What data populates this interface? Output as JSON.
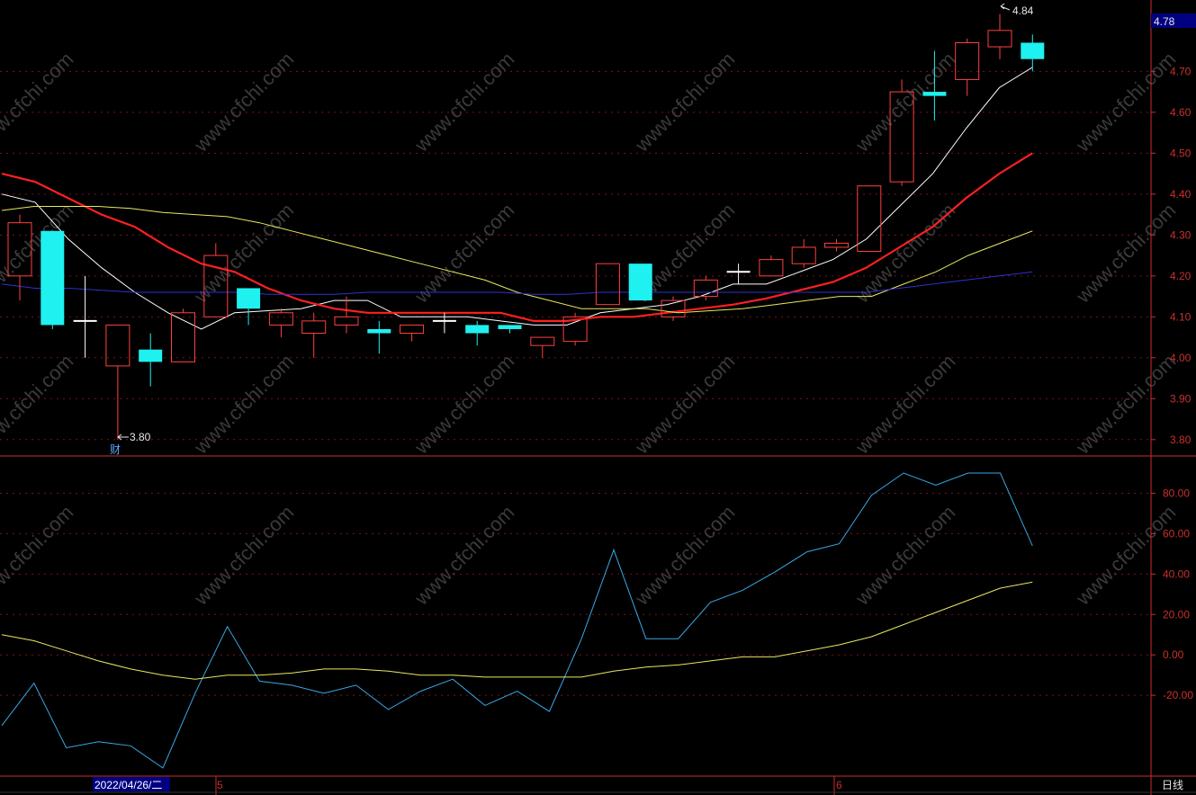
{
  "chart_data": [
    {
      "type": "candlestick",
      "ylim": [
        3.76,
        4.87
      ],
      "yticks": [
        "4.70",
        "4.60",
        "4.50",
        "4.40",
        "4.30",
        "4.20",
        "4.10",
        "4.00",
        "3.90",
        "3.80"
      ],
      "current_price": "4.78",
      "high_marker": "4.84",
      "low_marker": "3.80",
      "event_marker": "财",
      "candles": [
        {
          "o": 4.2,
          "h": 4.35,
          "l": 4.14,
          "c": 4.33
        },
        {
          "o": 4.31,
          "h": 4.31,
          "l": 4.07,
          "c": 4.08
        },
        {
          "o": 4.09,
          "h": 4.2,
          "l": 4.0,
          "c": 4.09
        },
        {
          "o": 3.98,
          "h": 4.08,
          "l": 3.8,
          "c": 4.08
        },
        {
          "o": 4.02,
          "h": 4.06,
          "l": 3.93,
          "c": 3.99
        },
        {
          "o": 3.99,
          "h": 4.12,
          "l": 3.99,
          "c": 4.11
        },
        {
          "o": 4.1,
          "h": 4.28,
          "l": 4.1,
          "c": 4.25
        },
        {
          "o": 4.17,
          "h": 4.17,
          "l": 4.08,
          "c": 4.12
        },
        {
          "o": 4.08,
          "h": 4.12,
          "l": 4.05,
          "c": 4.11
        },
        {
          "o": 4.06,
          "h": 4.11,
          "l": 4.0,
          "c": 4.09
        },
        {
          "o": 4.08,
          "h": 4.15,
          "l": 4.06,
          "c": 4.1
        },
        {
          "o": 4.07,
          "h": 4.09,
          "l": 4.01,
          "c": 4.06
        },
        {
          "o": 4.06,
          "h": 4.08,
          "l": 4.04,
          "c": 4.08
        },
        {
          "o": 4.09,
          "h": 4.11,
          "l": 4.06,
          "c": 4.09
        },
        {
          "o": 4.08,
          "h": 4.09,
          "l": 4.03,
          "c": 4.06
        },
        {
          "o": 4.08,
          "h": 4.08,
          "l": 4.06,
          "c": 4.07
        },
        {
          "o": 4.03,
          "h": 4.05,
          "l": 4.0,
          "c": 4.05
        },
        {
          "o": 4.04,
          "h": 4.11,
          "l": 4.03,
          "c": 4.1
        },
        {
          "o": 4.13,
          "h": 4.23,
          "l": 4.13,
          "c": 4.23
        },
        {
          "o": 4.23,
          "h": 4.23,
          "l": 4.14,
          "c": 4.14
        },
        {
          "o": 4.1,
          "h": 4.15,
          "l": 4.09,
          "c": 4.14
        },
        {
          "o": 4.15,
          "h": 4.2,
          "l": 4.14,
          "c": 4.19
        },
        {
          "o": 4.21,
          "h": 4.23,
          "l": 4.18,
          "c": 4.21
        },
        {
          "o": 4.2,
          "h": 4.25,
          "l": 4.2,
          "c": 4.24
        },
        {
          "o": 4.23,
          "h": 4.29,
          "l": 4.22,
          "c": 4.27
        },
        {
          "o": 4.27,
          "h": 4.29,
          "l": 4.26,
          "c": 4.28
        },
        {
          "o": 4.26,
          "h": 4.42,
          "l": 4.26,
          "c": 4.42
        },
        {
          "o": 4.43,
          "h": 4.68,
          "l": 4.42,
          "c": 4.65
        },
        {
          "o": 4.65,
          "h": 4.75,
          "l": 4.58,
          "c": 4.64
        },
        {
          "o": 4.68,
          "h": 4.78,
          "l": 4.64,
          "c": 4.77
        },
        {
          "o": 4.76,
          "h": 4.84,
          "l": 4.73,
          "c": 4.8
        },
        {
          "o": 4.77,
          "h": 4.79,
          "l": 4.7,
          "c": 4.73
        }
      ],
      "ma_series": [
        {
          "color": "#ffffff",
          "values": [
            4.4,
            4.38,
            4.29,
            4.22,
            4.16,
            4.11,
            4.07,
            4.11,
            4.115,
            4.12,
            4.14,
            4.14,
            4.1,
            4.1,
            4.1,
            4.09,
            4.08,
            4.08,
            4.11,
            4.12,
            4.13,
            4.15,
            4.18,
            4.18,
            4.21,
            4.24,
            4.29,
            4.37,
            4.45,
            4.56,
            4.66,
            4.71
          ]
        },
        {
          "color": "#ff2020",
          "values": [
            4.45,
            4.43,
            4.39,
            4.35,
            4.32,
            4.27,
            4.23,
            4.21,
            4.17,
            4.14,
            4.12,
            4.11,
            4.11,
            4.11,
            4.11,
            4.11,
            4.09,
            4.09,
            4.1,
            4.1,
            4.11,
            4.12,
            4.13,
            4.145,
            4.165,
            4.185,
            4.22,
            4.27,
            4.32,
            4.39,
            4.45,
            4.5
          ]
        },
        {
          "color": "#e8e860",
          "values": [
            4.36,
            4.37,
            4.37,
            4.37,
            4.365,
            4.355,
            4.35,
            4.345,
            4.33,
            4.31,
            4.29,
            4.27,
            4.25,
            4.23,
            4.21,
            4.19,
            4.16,
            4.14,
            4.12,
            4.12,
            4.12,
            4.11,
            4.115,
            4.12,
            4.13,
            4.14,
            4.15,
            4.15,
            4.18,
            4.21,
            4.25,
            4.28,
            4.31
          ]
        },
        {
          "color": "#3030d0",
          "values": [
            4.18,
            4.17,
            4.17,
            4.165,
            4.16,
            4.16,
            4.16,
            4.16,
            4.155,
            4.155,
            4.155,
            4.16,
            4.16,
            4.16,
            4.16,
            4.16,
            4.155,
            4.155,
            4.16,
            4.16,
            4.16,
            4.16,
            4.16,
            4.16,
            4.16,
            4.16,
            4.16,
            4.17,
            4.18,
            4.19,
            4.2,
            4.21
          ]
        }
      ]
    },
    {
      "type": "line",
      "ylim": [
        -60,
        98
      ],
      "yticks": [
        "80.00",
        "60.00",
        "40.00",
        "20.00",
        "0.00",
        "-20.00"
      ],
      "series": [
        {
          "color": "#39a8e6",
          "values": [
            -35,
            -14,
            -46,
            -43,
            -45,
            -56,
            -19,
            14,
            -13,
            -15,
            -19,
            -15,
            -27,
            -18,
            -12,
            -25,
            -18,
            -28,
            8,
            52,
            8,
            8,
            26,
            32,
            41,
            51,
            55,
            79,
            90,
            84,
            90,
            90,
            54
          ]
        },
        {
          "color": "#e8e860",
          "values": [
            10,
            7,
            2,
            -3,
            -7,
            -10,
            -12,
            -10,
            -10,
            -9,
            -7,
            -7,
            -8,
            -10,
            -10,
            -11,
            -11,
            -11,
            -11,
            -8,
            -6,
            -5,
            -3,
            -1,
            -1,
            2,
            5,
            9,
            15,
            21,
            27,
            33,
            36
          ]
        }
      ]
    }
  ],
  "xaxis": {
    "date_label": "2022/04/26/二",
    "month_labels": [
      "5",
      "6"
    ],
    "period": "日线"
  },
  "watermark": "www.cfchi.com",
  "colors": {
    "up": "#ff4040",
    "down": "#1ff0f0",
    "axis": "#c8302c",
    "grid": "#7a1414",
    "background": "#000000"
  }
}
